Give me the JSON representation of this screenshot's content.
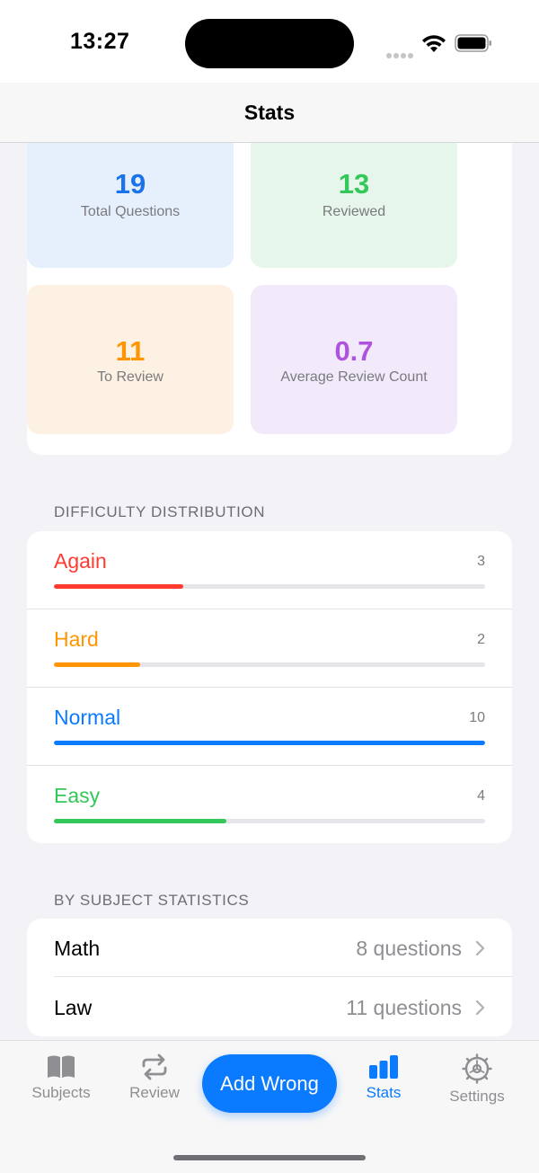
{
  "status_bar": {
    "time": "13:27"
  },
  "nav": {
    "title": "Stats"
  },
  "summary": [
    {
      "value": "19",
      "label": "Total Questions",
      "color": "#1a73e8"
    },
    {
      "value": "13",
      "label": "Reviewed",
      "color": "#34c759"
    },
    {
      "value": "11",
      "label": "To Review",
      "color": "#ff9500"
    },
    {
      "value": "0.7",
      "label": "Average Review Count",
      "color": "#af52de"
    }
  ],
  "difficulty": {
    "header": "DIFFICULTY DISTRIBUTION",
    "max_count": 10,
    "items": [
      {
        "name": "Again",
        "count": "3",
        "fraction": 0.3,
        "color": "#ff3b30"
      },
      {
        "name": "Hard",
        "count": "2",
        "fraction": 0.2,
        "color": "#ff9500"
      },
      {
        "name": "Normal",
        "count": "10",
        "fraction": 1.0,
        "color": "#0a7aff"
      },
      {
        "name": "Easy",
        "count": "4",
        "fraction": 0.4,
        "color": "#34c759"
      }
    ]
  },
  "subjects": {
    "header": "BY SUBJECT STATISTICS",
    "items": [
      {
        "name": "Math",
        "count": "8 questions"
      },
      {
        "name": "Law",
        "count": "11 questions"
      }
    ]
  },
  "tab_bar": {
    "subjects": "Subjects",
    "review": "Review",
    "add_wrong": "Add Wrong",
    "stats": "Stats",
    "settings": "Settings",
    "active_color": "#0a7aff",
    "inactive_color": "#8e8e93"
  }
}
